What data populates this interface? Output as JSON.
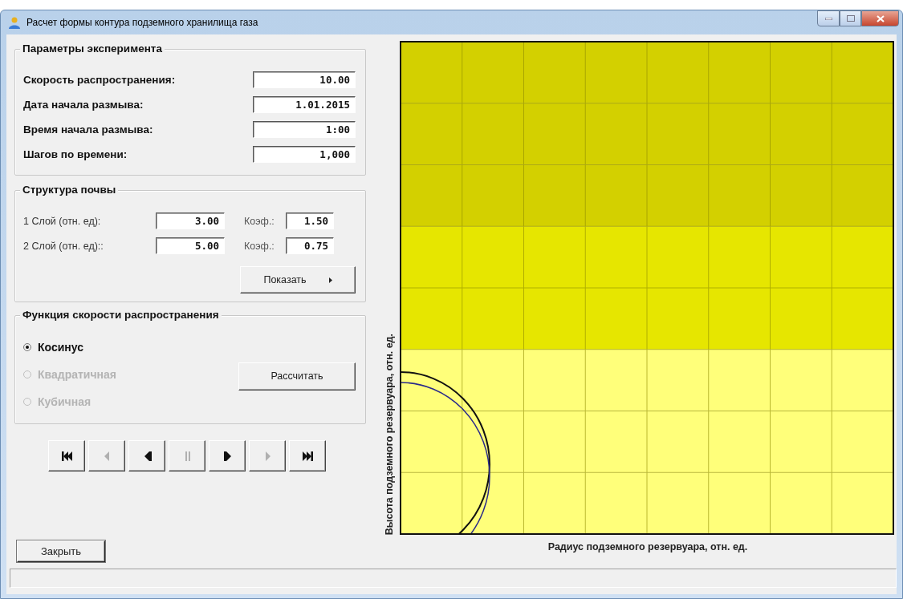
{
  "window": {
    "title": "Расчет формы контура подземного хранилища газа"
  },
  "experiment": {
    "title": "Параметры эксперимента",
    "fields": [
      {
        "label": "Скорость распространения:",
        "value": "10.00"
      },
      {
        "label": "Дата начала размыва:",
        "value": "1.01.2015"
      },
      {
        "label": "Время начала размыва:",
        "value": "1:00"
      },
      {
        "label": "Шагов по времени:",
        "value": "1,000"
      }
    ]
  },
  "soil": {
    "title": "Структура почвы",
    "layers": [
      {
        "label": "1 Слой (отн. ед):",
        "value": "3.00",
        "coef_label": "Коэф.:",
        "coef": "1.50"
      },
      {
        "label": "2 Слой (отн. ед)::",
        "value": "5.00",
        "coef_label": "Коэф.:",
        "coef": "0.75"
      }
    ],
    "show_button": "Показать"
  },
  "speed_function": {
    "title": "Функция скорости распространения",
    "options": [
      {
        "label": "Косинус",
        "selected": true,
        "disabled": false
      },
      {
        "label": "Квадратичная",
        "selected": false,
        "disabled": true
      },
      {
        "label": "Кубичная",
        "selected": false,
        "disabled": true
      }
    ],
    "calc_button": "Рассчитать"
  },
  "playback": [
    {
      "kind": "first",
      "disabled": false
    },
    {
      "kind": "prev",
      "disabled": true
    },
    {
      "kind": "back",
      "disabled": false
    },
    {
      "kind": "pause",
      "disabled": true
    },
    {
      "kind": "play",
      "disabled": false
    },
    {
      "kind": "next",
      "disabled": true
    },
    {
      "kind": "last",
      "disabled": false
    }
  ],
  "close_button": "Закрыть",
  "plot": {
    "ylabel": "Высота подземного резервуара, отн. ед.",
    "xlabel": "Радиус подземного резервуара, отн. ед.",
    "rows": [
      {
        "color": "#d3d000"
      },
      {
        "color": "#d3d000"
      },
      {
        "color": "#d3d000"
      },
      {
        "color": "#e6e600"
      },
      {
        "color": "#e6e600"
      },
      {
        "color": "#ffff7a"
      },
      {
        "color": "#ffff7a"
      },
      {
        "color": "#ffff7a"
      }
    ]
  }
}
